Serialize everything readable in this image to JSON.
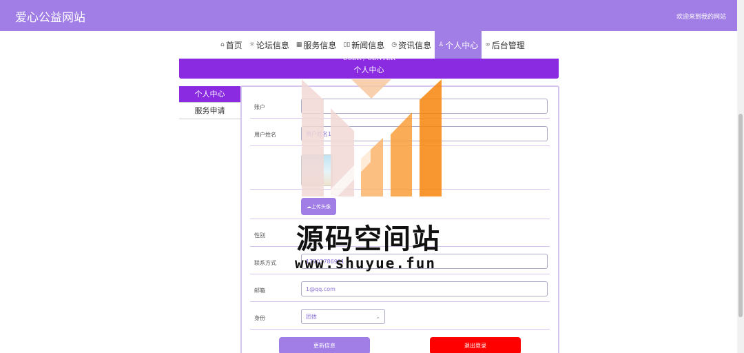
{
  "header": {
    "site_title": "爱心公益网站",
    "welcome": "欢迎来到我的网站"
  },
  "nav": [
    {
      "label": "首页",
      "icon": "home-icon",
      "glyph": "⌂"
    },
    {
      "label": "论坛信息",
      "icon": "forum-icon",
      "glyph": "☼"
    },
    {
      "label": "服务信息",
      "icon": "service-icon",
      "glyph": "▦"
    },
    {
      "label": "新闻信息",
      "icon": "news-icon",
      "glyph": "▯▯"
    },
    {
      "label": "资讯信息",
      "icon": "clock-icon",
      "glyph": "◷"
    },
    {
      "label": "个人中心",
      "icon": "user-icon",
      "glyph": "♙"
    },
    {
      "label": "后台管理",
      "icon": "link-icon",
      "glyph": "∞"
    }
  ],
  "banner": {
    "title_en": "USER / CENTER",
    "title_cn": "个人中心"
  },
  "sidebar": {
    "items": [
      {
        "label": "个人中心"
      },
      {
        "label": "服务申请"
      }
    ]
  },
  "form": {
    "account_label": "账户",
    "account_value": "",
    "username_label": "用户姓名",
    "username_value": "用户姓名1",
    "upload_label": "上传头像",
    "gender_label": "性别",
    "contact_label": "联系方式",
    "contact_value": "17703786901",
    "email_label": "邮箱",
    "email_value": "1@qq.com",
    "identity_label": "身份",
    "identity_value": "团体",
    "update_button": "更新信息",
    "logout_button": "退出登录"
  },
  "watermark": {
    "title": "源码空间站",
    "url": "www.shuyue.fun"
  },
  "colors": {
    "primary": "#a07ee6",
    "banner": "#8a2be2",
    "danger": "#ff0000"
  }
}
